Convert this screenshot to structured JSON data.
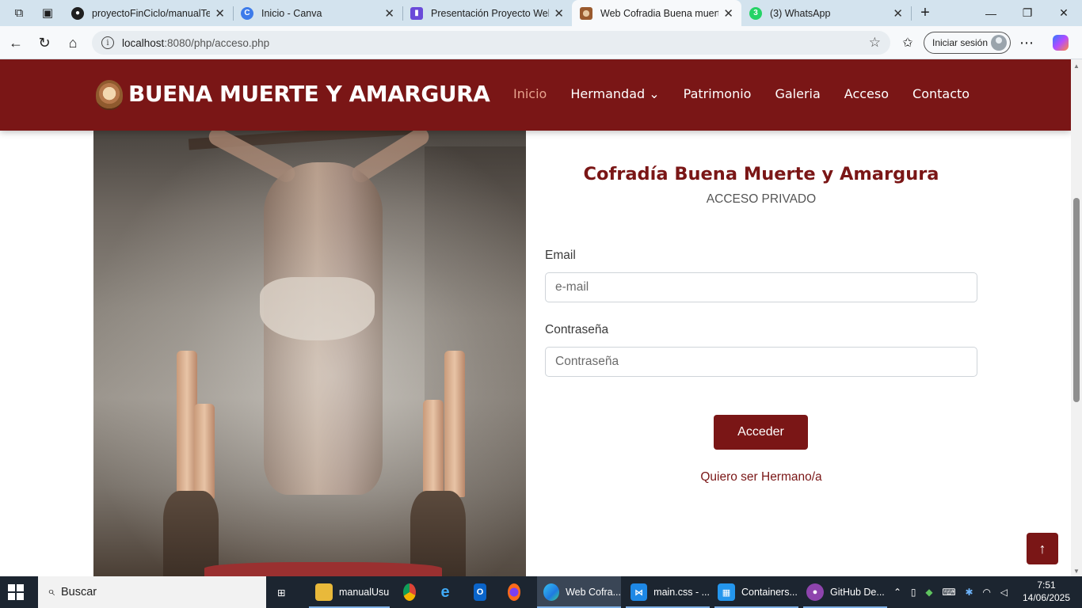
{
  "browser": {
    "tabs": [
      {
        "title": "proyectoFinCiclo/manualTec",
        "favicon": "github-icon"
      },
      {
        "title": "Inicio - Canva",
        "favicon": "canva-icon"
      },
      {
        "title": "Presentación Proyecto Web E",
        "favicon": "slides-icon"
      },
      {
        "title": "Web Cofradia Buena muerte",
        "favicon": "cofradia-icon",
        "active": true
      },
      {
        "title": "(3) WhatsApp",
        "favicon": "whatsapp-icon"
      }
    ],
    "address": {
      "host": "localhost",
      "rest": ":8080/php/acceso.php"
    },
    "signin_label": "Iniciar sesión"
  },
  "site": {
    "brand": "BUENA MUERTE Y AMARGURA",
    "nav": [
      "Inicio",
      "Hermandad",
      "Patrimonio",
      "Galeria",
      "Acceso",
      "Contacto"
    ],
    "nav_current": "Inicio",
    "dropdown_caret": "⌄"
  },
  "login": {
    "title": "Cofradía Buena Muerte y Amargura",
    "subtitle": "ACCESO PRIVADO",
    "email_label": "Email",
    "email_placeholder": "e-mail",
    "email_value": "",
    "password_label": "Contraseña",
    "password_placeholder": "Contraseña",
    "password_value": "",
    "submit_label": "Acceder",
    "join_link": "Quiero ser Hermano/a"
  },
  "back_to_top": "↑",
  "taskbar": {
    "search_placeholder": "Buscar",
    "items": [
      {
        "label": "manualUsu",
        "icon": "folder-icon"
      },
      {
        "label": "Web Cofra...",
        "icon": "edge-icon"
      },
      {
        "label": "main.css - ...",
        "icon": "vscode-icon"
      },
      {
        "label": "Containers...",
        "icon": "docker-icon"
      },
      {
        "label": "GitHub De...",
        "icon": "github-desktop-icon"
      }
    ],
    "time": "7:51",
    "date": "14/06/2025"
  },
  "colors": {
    "brand": "#7a1616",
    "nav_current": "#e7a28d",
    "taskbar": "#1c2530"
  }
}
